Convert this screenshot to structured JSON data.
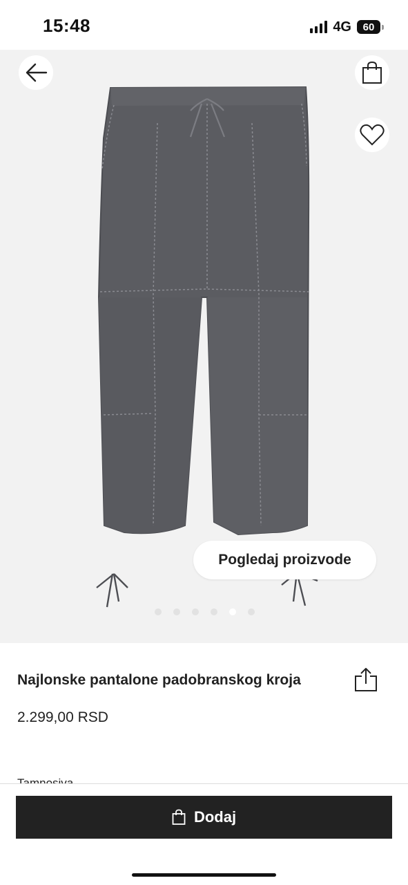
{
  "status_bar": {
    "time": "15:48",
    "network": "4G",
    "battery": "60"
  },
  "header": {
    "back_icon": "arrow-left-icon",
    "bag_icon": "shopping-bag-icon",
    "wishlist_icon": "heart-icon"
  },
  "gallery": {
    "view_products_label": "Pogledaj proizvode",
    "dots": [
      "",
      "",
      "",
      "",
      "active",
      ""
    ],
    "product_color": "#5c5d62"
  },
  "product": {
    "title": "Najlonske pantalone padobranskog kroja",
    "price": "2.299,00 RSD",
    "partial_text": "Tamnosiva",
    "share_icon": "share-icon"
  },
  "cta": {
    "add_label": "Dodaj",
    "bag_icon": "shopping-bag-icon"
  },
  "colors": {
    "button_bg": "#222222",
    "image_bg": "#f2f2f2"
  }
}
